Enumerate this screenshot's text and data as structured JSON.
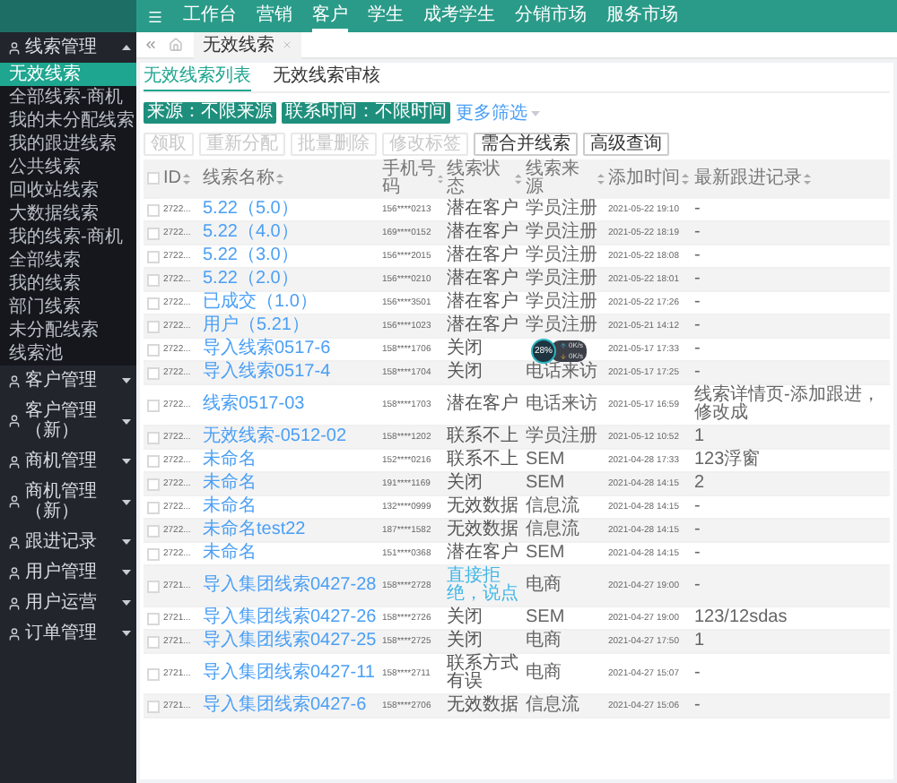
{
  "top_nav": {
    "items": [
      {
        "label": "工作台",
        "selected": false
      },
      {
        "label": "营销",
        "selected": false
      },
      {
        "label": "客户",
        "selected": true
      },
      {
        "label": "学生",
        "selected": false
      },
      {
        "label": "成考学生",
        "selected": false
      },
      {
        "label": "分销市场",
        "selected": false
      },
      {
        "label": "服务市场",
        "selected": false
      }
    ]
  },
  "sidebar": {
    "groups": [
      {
        "label": "线索管理",
        "expanded": true,
        "items": [
          {
            "label": "无效线索",
            "selected": true
          },
          {
            "label": "全部线索-商机",
            "selected": false
          },
          {
            "label": "我的未分配线索",
            "selected": false
          },
          {
            "label": "我的跟进线索",
            "selected": false
          },
          {
            "label": "公共线索",
            "selected": false
          },
          {
            "label": "回收站线索",
            "selected": false
          },
          {
            "label": "大数据线索",
            "selected": false
          },
          {
            "label": "我的线索-商机",
            "selected": false
          },
          {
            "label": "全部线索",
            "selected": false
          },
          {
            "label": "我的线索",
            "selected": false
          },
          {
            "label": "部门线索",
            "selected": false
          },
          {
            "label": "未分配线索",
            "selected": false
          },
          {
            "label": "线索池",
            "selected": false
          }
        ]
      },
      {
        "label": "客户管理",
        "expanded": false
      },
      {
        "label": "客户管理（新）",
        "expanded": false
      },
      {
        "label": "商机管理",
        "expanded": false
      },
      {
        "label": "商机管理（新）",
        "expanded": false
      },
      {
        "label": "跟进记录",
        "expanded": false
      },
      {
        "label": "用户管理",
        "expanded": false
      },
      {
        "label": "用户运营",
        "expanded": false
      },
      {
        "label": "订单管理",
        "expanded": false
      }
    ]
  },
  "page_tabs": [
    {
      "label": "无效线索",
      "selected": true
    }
  ],
  "sub_tabs": [
    {
      "label": "无效线索列表",
      "selected": true
    },
    {
      "label": "无效线索审核",
      "selected": false
    }
  ],
  "filters": {
    "tags": [
      "来源：不限来源",
      "联系时间：不限时间"
    ],
    "more": "更多筛选"
  },
  "actions": [
    {
      "label": "领取",
      "disabled": true
    },
    {
      "label": "重新分配",
      "disabled": true
    },
    {
      "label": "批量删除",
      "disabled": true
    },
    {
      "label": "修改标签",
      "disabled": true
    },
    {
      "label": "需合并线索",
      "disabled": false
    },
    {
      "label": "高级查询",
      "disabled": false
    }
  ],
  "table": {
    "all_checked": false,
    "columns": [
      "ID",
      "线索名称",
      "手机号码",
      "线索状态",
      "线索来源",
      "添加时间",
      "最新跟进记录"
    ],
    "rows": [
      {
        "id": "2722...",
        "name": "5.22（5.0）",
        "phone": "156****0213",
        "status": "潜在客户",
        "source": "学员注册",
        "time": "2021-05-22 19:10",
        "last": "-",
        "checked": false
      },
      {
        "id": "2722...",
        "name": "5.22（4.0）",
        "phone": "169****0152",
        "status": "潜在客户",
        "source": "学员注册",
        "time": "2021-05-22 18:19",
        "last": "-",
        "checked": false
      },
      {
        "id": "2722...",
        "name": "5.22（3.0）",
        "phone": "156****2015",
        "status": "潜在客户",
        "source": "学员注册",
        "time": "2021-05-22 18:08",
        "last": "-",
        "checked": false
      },
      {
        "id": "2722...",
        "name": "5.22（2.0）",
        "phone": "156****0210",
        "status": "潜在客户",
        "source": "学员注册",
        "time": "2021-05-22 18:01",
        "last": "-",
        "checked": false
      },
      {
        "id": "2722...",
        "name": "已成交（1.0）",
        "phone": "156****3501",
        "status": "潜在客户",
        "source": "学员注册",
        "time": "2021-05-22 17:26",
        "last": "-",
        "checked": false
      },
      {
        "id": "2722...",
        "name": "用户（5.21）",
        "phone": "156****1023",
        "status": "潜在客户",
        "source": "学员注册",
        "time": "2021-05-21 14:12",
        "last": "-",
        "checked": false
      },
      {
        "id": "2722...",
        "name": "导入线索0517-6",
        "phone": "158****1706",
        "status": "关闭",
        "time": "2021-05-17 17:33",
        "last": "-",
        "checked": false
      },
      {
        "id": "2722...",
        "name": "导入线索0517-4",
        "phone": "158****1704",
        "status": "关闭",
        "source": "电话来访",
        "time": "2021-05-17 17:25",
        "last": "-",
        "checked": false
      },
      {
        "id": "2722...",
        "name": "线索0517-03",
        "phone": "158****1703",
        "status": "潜在客户",
        "source": "电话来访",
        "time": "2021-05-17 16:59",
        "last": "线索详情页-添加跟进，修改成",
        "checked": false
      },
      {
        "id": "2722...",
        "name": "无效线索-0512-02",
        "phone": "158****1202",
        "status": "联系不上",
        "source": "学员注册",
        "time": "2021-05-12 10:52",
        "last": "1",
        "checked": false
      },
      {
        "id": "2722...",
        "name": "未命名",
        "phone": "152****0216",
        "status": "联系不上",
        "source": "SEM",
        "time": "2021-04-28 17:33",
        "last": "123浮窗",
        "checked": false
      },
      {
        "id": "2722...",
        "name": "未命名",
        "phone": "191****1169",
        "status": "关闭",
        "source": "SEM",
        "time": "2021-04-28 14:15",
        "last": "2",
        "checked": false
      },
      {
        "id": "2722...",
        "name": "未命名",
        "phone": "132****0999",
        "status": "无效数据",
        "source": "信息流",
        "time": "2021-04-28 14:15",
        "last": "-",
        "checked": false
      },
      {
        "id": "2722...",
        "name": "未命名test22",
        "phone": "187****1582",
        "status": "无效数据",
        "source": "信息流",
        "time": "2021-04-28 14:15",
        "last": "-",
        "checked": false
      },
      {
        "id": "2722...",
        "name": "未命名",
        "phone": "151****0368",
        "status": "潜在客户",
        "source": "SEM",
        "time": "2021-04-28 14:15",
        "last": "-",
        "checked": false
      },
      {
        "id": "2721...",
        "name": "导入集团线索0427-28",
        "phone": "158****2728",
        "status": "直接拒绝，说点",
        "status_link": true,
        "source": "电商",
        "time": "2021-04-27 19:00",
        "last": "-",
        "checked": false
      },
      {
        "id": "2721...",
        "name": "导入集团线索0427-26",
        "phone": "158****2726",
        "status": "关闭",
        "source": "SEM",
        "time": "2021-04-27 19:00",
        "last": "123/12sdas",
        "checked": false
      },
      {
        "id": "2721...",
        "name": "导入集团线索0427-25",
        "phone": "158****2725",
        "status": "关闭",
        "source": "电商",
        "time": "2021-04-27 17:50",
        "last": "1",
        "checked": false
      },
      {
        "id": "2721...",
        "name": "导入集团线索0427-11",
        "phone": "158****2711",
        "status": "联系方式有误",
        "source": "电商",
        "time": "2021-04-27 15:07",
        "last": "-",
        "checked": false
      },
      {
        "id": "2721...",
        "name": "导入集团线索0427-6",
        "phone": "158****2706",
        "status": "无效数据",
        "source": "信息流",
        "time": "2021-04-27 15:06",
        "last": "-",
        "checked": false
      }
    ]
  },
  "speed_widget": {
    "percent": "28",
    "unit": "%",
    "rates": [
      "0K/s",
      "0K/s"
    ]
  }
}
